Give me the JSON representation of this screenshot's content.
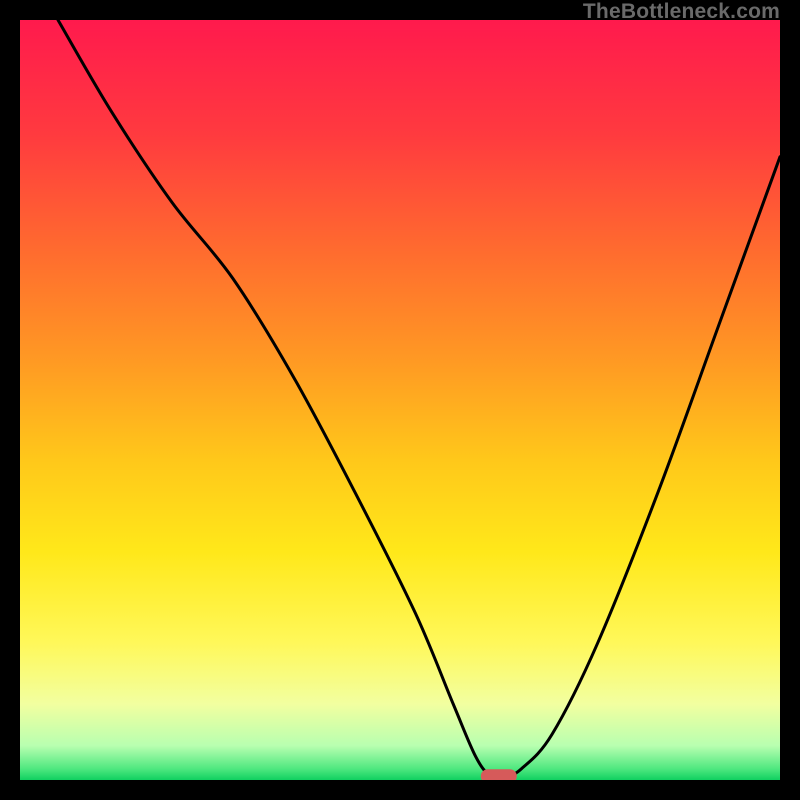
{
  "watermark": "TheBottleneck.com",
  "chart_data": {
    "type": "line",
    "title": "",
    "xlabel": "",
    "ylabel": "",
    "xlim": [
      0,
      100
    ],
    "ylim": [
      0,
      100
    ],
    "grid": false,
    "legend": false,
    "curve": {
      "name": "bottleneck-curve",
      "x": [
        5,
        12,
        20,
        28,
        36,
        44,
        52,
        57,
        60,
        62,
        64,
        66,
        70,
        76,
        84,
        92,
        100
      ],
      "y": [
        100,
        88,
        76,
        66,
        53,
        38,
        22,
        10,
        3,
        0.5,
        0.5,
        1.5,
        6,
        18,
        38,
        60,
        82
      ]
    },
    "marker": {
      "name": "optimal-point",
      "x": 63,
      "y": 0.5,
      "color": "#d65a5a",
      "shape": "pill"
    },
    "background_gradient": {
      "stops": [
        {
          "pos": 0.0,
          "color": "#ff1a4d"
        },
        {
          "pos": 0.15,
          "color": "#ff3a3f"
        },
        {
          "pos": 0.3,
          "color": "#ff6a2f"
        },
        {
          "pos": 0.45,
          "color": "#ff9a23"
        },
        {
          "pos": 0.58,
          "color": "#ffc81a"
        },
        {
          "pos": 0.7,
          "color": "#ffe81a"
        },
        {
          "pos": 0.82,
          "color": "#fff85a"
        },
        {
          "pos": 0.9,
          "color": "#f2ffa0"
        },
        {
          "pos": 0.955,
          "color": "#b8ffb0"
        },
        {
          "pos": 0.985,
          "color": "#50e880"
        },
        {
          "pos": 1.0,
          "color": "#10d060"
        }
      ]
    }
  }
}
